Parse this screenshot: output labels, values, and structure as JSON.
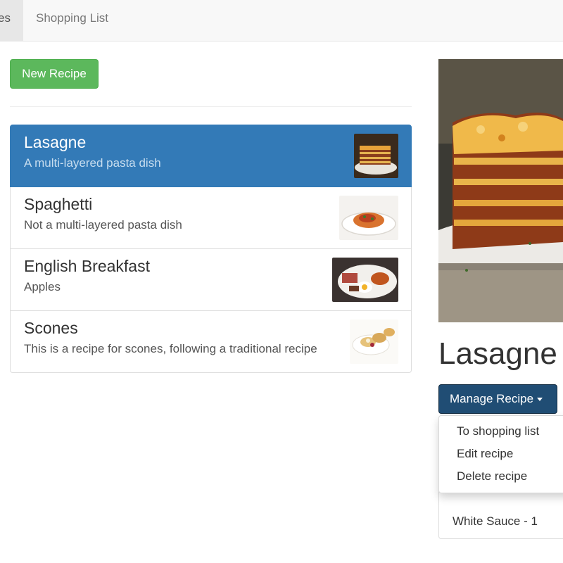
{
  "navbar": {
    "tabs": [
      {
        "label": "Recipes",
        "active": true
      },
      {
        "label": "Shopping List",
        "active": false
      }
    ]
  },
  "recipe_list": {
    "new_button_label": "New Recipe",
    "items": [
      {
        "name": "Lasagne",
        "description": "A multi-layered pasta dish",
        "active": true,
        "image": "lasagne-thumbnail"
      },
      {
        "name": "Spaghetti",
        "description": "Not a multi-layered pasta dish",
        "active": false,
        "image": "spaghetti-thumbnail"
      },
      {
        "name": "English Breakfast",
        "description": "Apples",
        "active": false,
        "image": "english-breakfast-thumbnail"
      },
      {
        "name": "Scones",
        "description": "This is a recipe for scones, following a traditional recipe",
        "active": false,
        "image": "scones-thumbnail"
      }
    ]
  },
  "detail": {
    "title": "Lasagne",
    "image": "lasagne-photo",
    "manage_button_label": "Manage Recipe",
    "dropdown_items": [
      "To shopping list",
      "Edit recipe",
      "Delete recipe"
    ],
    "ingredients": [
      {
        "label": "White Sauce - 1"
      }
    ]
  },
  "colors": {
    "primary": "#337ab7",
    "success": "#5cb85c",
    "manage_button": "#204d74",
    "navbar_bg": "#f8f8f8"
  }
}
